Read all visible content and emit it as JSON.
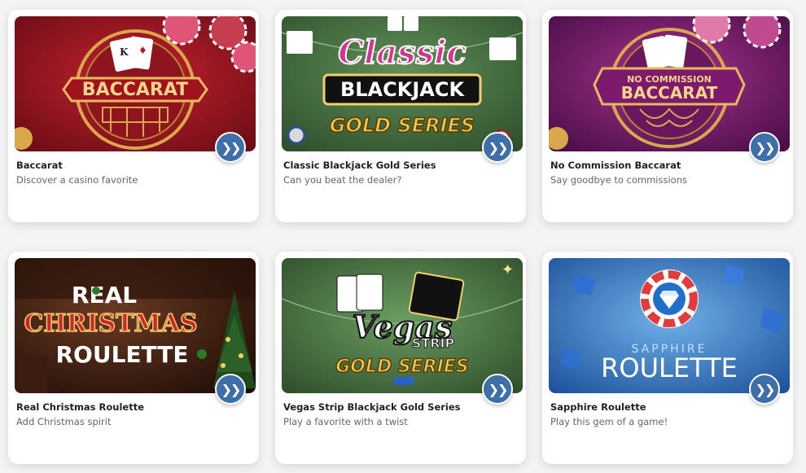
{
  "games": [
    {
      "title": "Baccarat",
      "description": "Discover a casino favorite",
      "art_lines": [
        "BACCARAT"
      ]
    },
    {
      "title": "Classic Blackjack Gold Series",
      "description": "Can you beat the dealer?",
      "art_lines": [
        "Classic",
        "BLACKJACK",
        "GOLD SERIES"
      ]
    },
    {
      "title": "No Commission Baccarat",
      "description": "Say goodbye to commissions",
      "art_lines": [
        "NO COMMISSION",
        "BACCARAT"
      ]
    },
    {
      "title": "Real Christmas Roulette",
      "description": "Add Christmas spirit",
      "art_lines": [
        "REAL",
        "CHRISTMAS",
        "ROULETTE"
      ]
    },
    {
      "title": "Vegas Strip Blackjack Gold Series",
      "description": "Play a favorite with a twist",
      "art_lines": [
        "Vegas",
        "STRIP",
        "GOLD SERIES"
      ]
    },
    {
      "title": "Sapphire Roulette",
      "description": "Play this gem of a game!",
      "art_lines": [
        "SAPPHIRE",
        "ROULETTE"
      ]
    }
  ],
  "play_button_icon": "play-double-chevron-icon",
  "colors": {
    "play_button": "#3e6fa8",
    "card_bg": "#ffffff"
  }
}
